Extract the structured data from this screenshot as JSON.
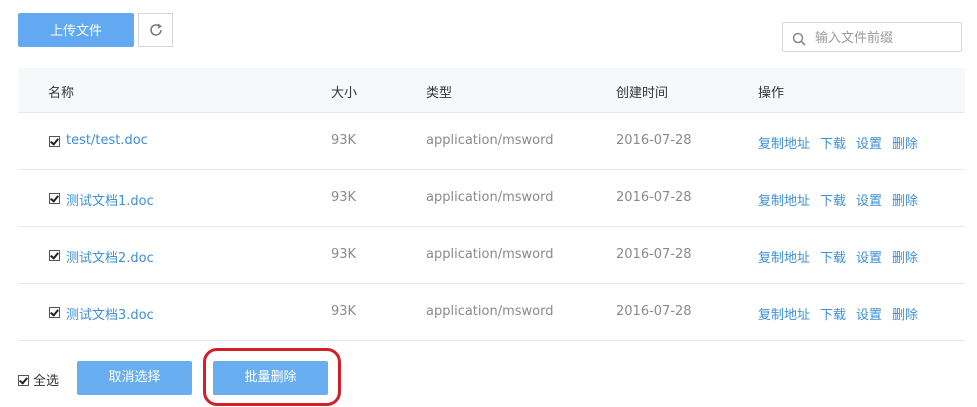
{
  "toolbar": {
    "upload_label": "上传文件",
    "refresh_icon": "refresh-icon"
  },
  "search": {
    "placeholder": "输入文件前缀",
    "icon": "search-icon"
  },
  "table": {
    "headers": {
      "name": "名称",
      "size": "大小",
      "type": "类型",
      "created": "创建时间",
      "actions": "操作"
    },
    "rows": [
      {
        "name": "test/test.doc",
        "size": "93K",
        "type": "application/msword",
        "date": "2016-07-28",
        "checked": true
      },
      {
        "name": "测试文档1.doc",
        "size": "93K",
        "type": "application/msword",
        "date": "2016-07-28",
        "checked": true
      },
      {
        "name": "测试文档2.doc",
        "size": "93K",
        "type": "application/msword",
        "date": "2016-07-28",
        "checked": true
      },
      {
        "name": "测试文档3.doc",
        "size": "93K",
        "type": "application/msword",
        "date": "2016-07-28",
        "checked": true
      }
    ],
    "actions": {
      "copy": "复制地址",
      "download": "下载",
      "settings": "设置",
      "delete": "删除"
    }
  },
  "footer": {
    "select_all_label": "全选",
    "select_all_checked": true,
    "cancel_label": "取消选择",
    "batch_delete_label": "批量删除"
  },
  "colors": {
    "primary": "#62a9f1",
    "link": "#3d8fd6",
    "highlight": "#d41f26"
  }
}
